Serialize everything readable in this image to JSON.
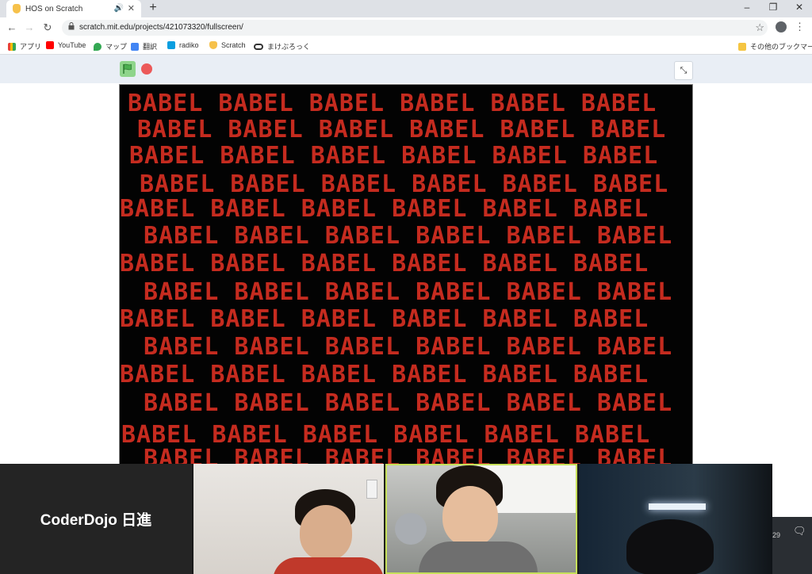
{
  "browser": {
    "tab_title": "HOS on Scratch",
    "url": "scratch.mit.edu/projects/421073320/fullscreen/",
    "new_tab": "+",
    "win_min": "–",
    "win_restore": "❐",
    "win_close": "✕",
    "back": "←",
    "forward": "→",
    "reload": "↻",
    "lock": "🔒",
    "star": "☆",
    "menu": "⋮"
  },
  "bookmarks": {
    "apps": "アプリ",
    "youtube": "YouTube",
    "maps": "マップ",
    "translate": "翻訳",
    "radiko": "radiko",
    "scratch": "Scratch",
    "makeblock": "まけぶろっく",
    "other": "その他のブックマーク"
  },
  "stage": {
    "word": "BABEL",
    "text_color": "#c52b1f",
    "background": "#030303"
  },
  "meeting": {
    "host_name": "CoderDojo 日進",
    "active_speaker_color": "#c6e05a"
  },
  "taskbar": {
    "time_fragment": "29"
  }
}
